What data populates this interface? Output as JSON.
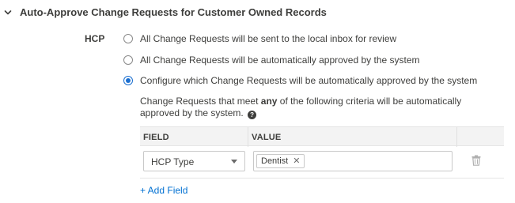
{
  "section": {
    "title": "Auto-Approve Change Requests for Customer Owned Records"
  },
  "field_label": "HCP",
  "options": [
    {
      "label": "All Change Requests will be sent to the local inbox for review",
      "checked": false
    },
    {
      "label": "All Change Requests will be automatically approved by the system",
      "checked": false
    },
    {
      "label": "Configure which Change Requests will be automatically approved by the system",
      "checked": true
    }
  ],
  "help": {
    "prefix": "Change Requests that meet ",
    "emphasis": "any",
    "suffix": " of the following criteria will be automatically approved by the system.",
    "icon": "question-icon",
    "icon_glyph": "?"
  },
  "table": {
    "headers": {
      "field": "FIELD",
      "value": "VALUE"
    },
    "rows": [
      {
        "field": "HCP Type",
        "values": [
          "Dentist"
        ],
        "remove_glyph": "✕"
      }
    ]
  },
  "add_field_label": "+ Add Field",
  "colors": {
    "accent": "#1b6fd0",
    "link": "#0070d2"
  }
}
